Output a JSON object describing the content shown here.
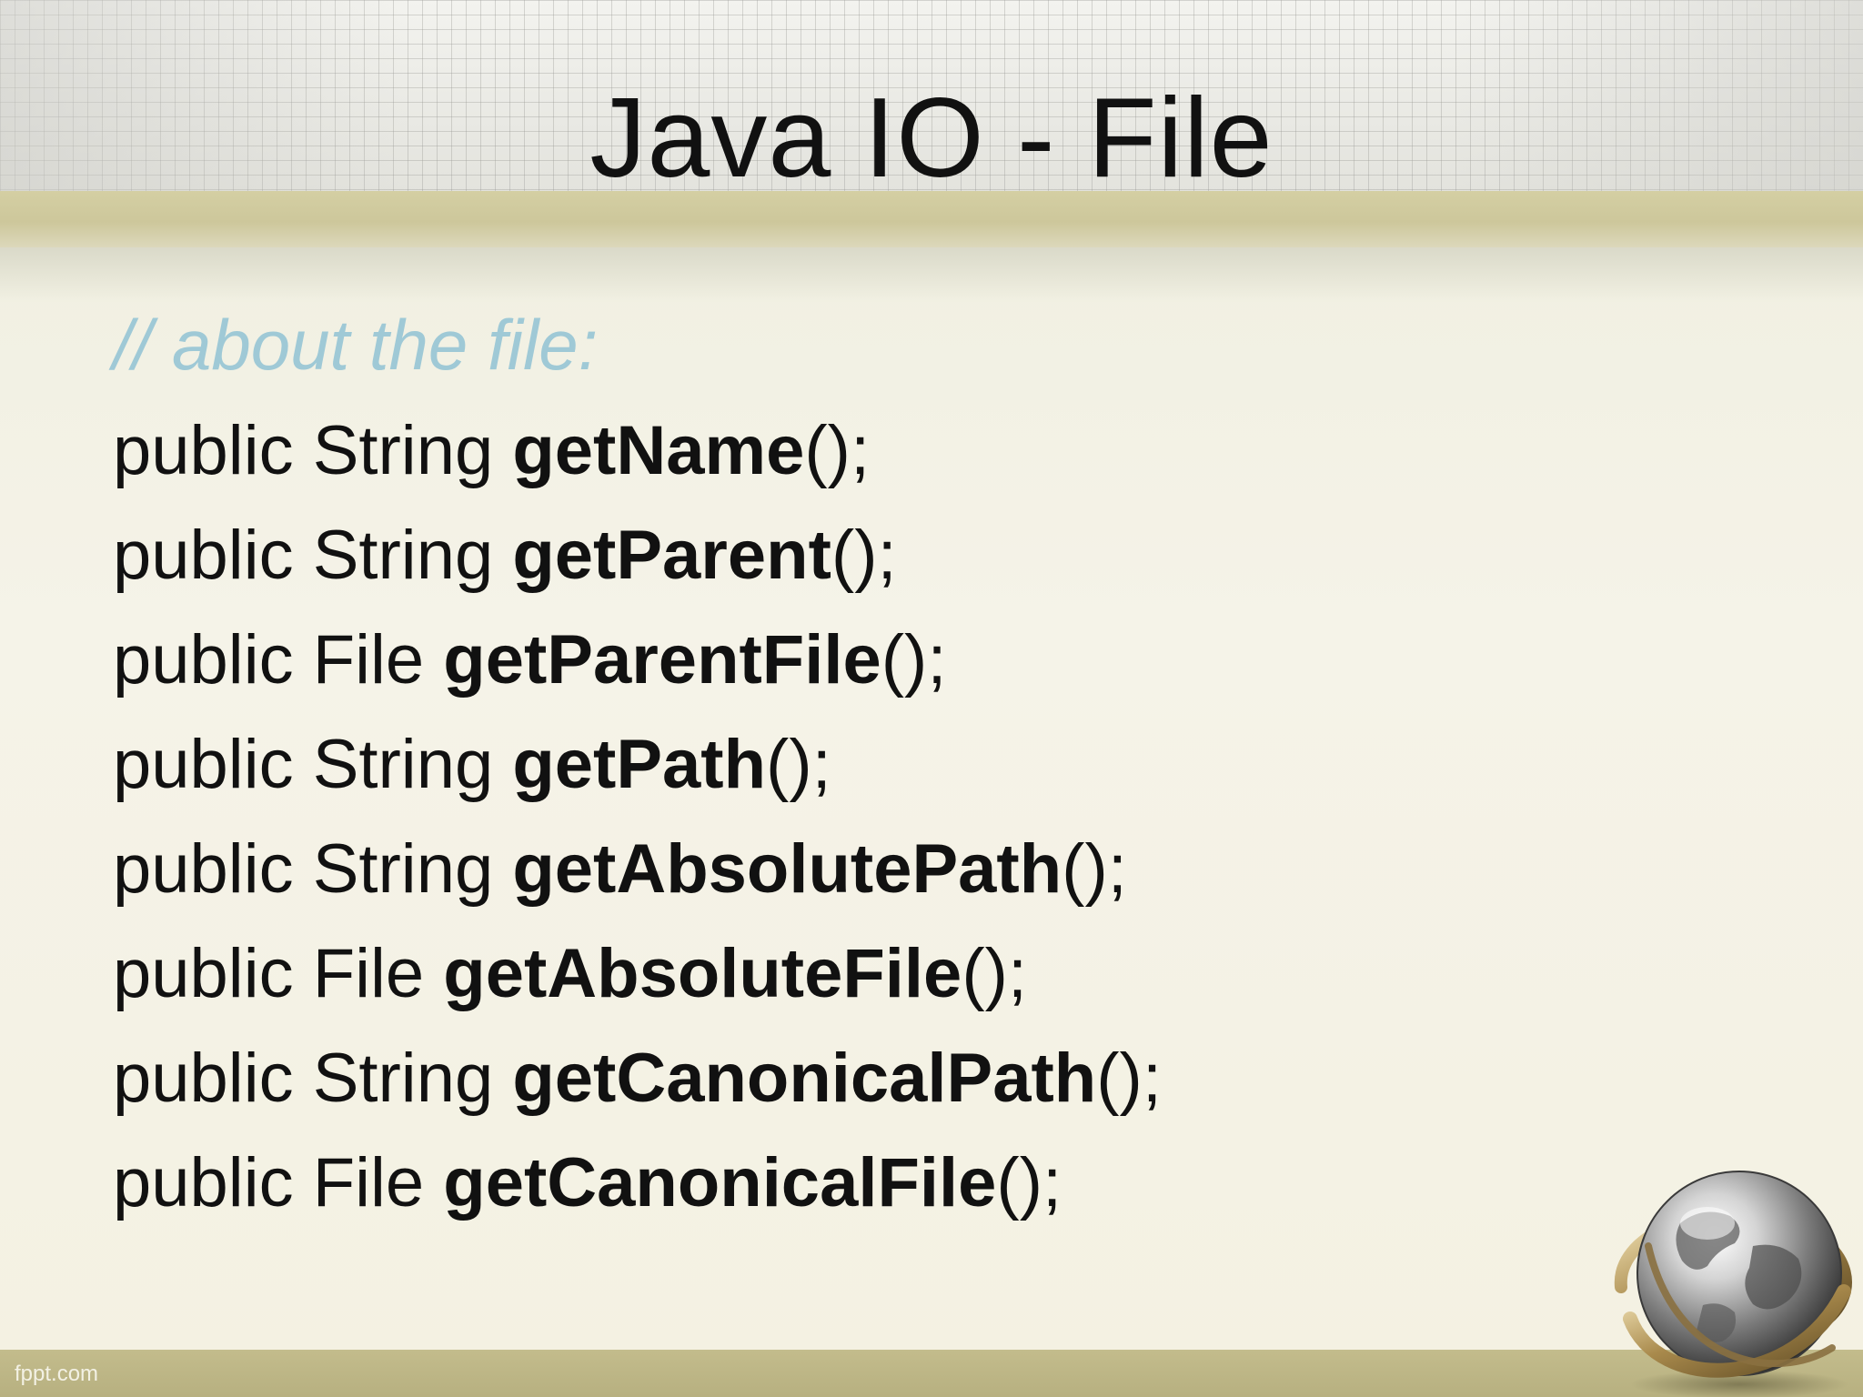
{
  "slide": {
    "title": "Java IO - File",
    "comment": "// about the file:",
    "lines": [
      {
        "prefix": "public String ",
        "method": "getName",
        "suffix": "();"
      },
      {
        "prefix": "public String ",
        "method": "getParent",
        "suffix": "();"
      },
      {
        "prefix": "public File ",
        "method": "getParentFile",
        "suffix": "();"
      },
      {
        "prefix": "public String ",
        "method": "getPath",
        "suffix": "();"
      },
      {
        "prefix": "public String ",
        "method": "getAbsolutePath",
        "suffix": "();"
      },
      {
        "prefix": "public File ",
        "method": "getAbsoluteFile",
        "suffix": "();"
      },
      {
        "prefix": "public String ",
        "method": "getCanonicalPath",
        "suffix": "();"
      },
      {
        "prefix": "public File ",
        "method": "getCanonicalFile",
        "suffix": "();"
      }
    ]
  },
  "footer": {
    "brand": "fppt.com"
  },
  "decorations": {
    "globe": "globe-icon"
  },
  "colors": {
    "title": "#111111",
    "comment": "#9fc9d6",
    "code": "#111111",
    "band": "#cdc79b",
    "footer_band": "#bdb686"
  }
}
